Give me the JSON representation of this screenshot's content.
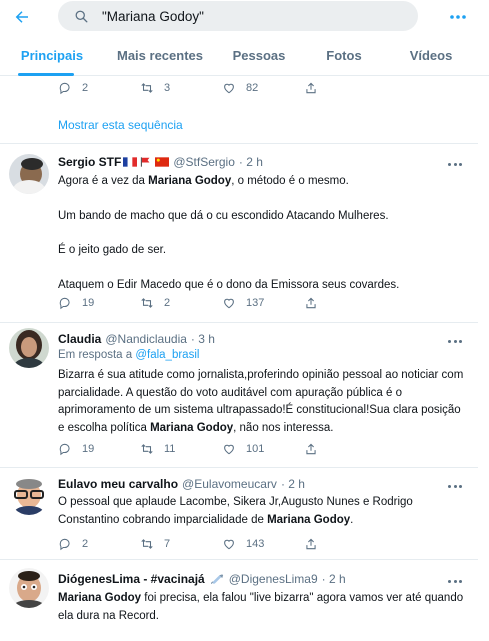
{
  "search": {
    "query": "\"Mariana Godoy\""
  },
  "tabs": [
    {
      "label": "Principais",
      "active": true
    },
    {
      "label": "Mais recentes",
      "active": false
    },
    {
      "label": "Pessoas",
      "active": false
    },
    {
      "label": "Fotos",
      "active": false
    },
    {
      "label": "Vídeos",
      "active": false
    }
  ],
  "prev_tweet": {
    "replies": "2",
    "retweets": "3",
    "likes": "82"
  },
  "show_thread": "Mostrar esta sequência",
  "tweets": [
    {
      "name": "Sergio STF",
      "handle": "@StfSergio",
      "time": "· 2 h",
      "pre": "Agora é a vez da ",
      "bold": "Mariana Godoy",
      "post": ", o método é o mesmo.",
      "p2": "Um bando de macho que dá o cu escondido Atacando Mulheres.",
      "p3": "É o jeito gado de ser.",
      "p4": "Ataquem o Edir Macedo que é o dono da Emissora seus covardes.",
      "replies": "19",
      "retweets": "2",
      "likes": "137"
    },
    {
      "name": "Claudia",
      "handle": "@Nandiclaudia",
      "time": "· 3 h",
      "reply_prefix": "Em resposta a ",
      "reply_to": "@fala_brasil",
      "pre": "Bizarra é sua atitude como jornalista,proferindo opinião pessoal ao noticiar com parcialidade. A questão do voto auditável com apuração pública é o aprimoramento de um sistema ultrapassado!É constitucional!Sua clara posição e escolha política ",
      "bold": "Mariana Godoy",
      "post": ", não nos interessa.",
      "replies": "19",
      "retweets": "11",
      "likes": "101"
    },
    {
      "name": "Eulavo meu carvalho",
      "handle": "@Eulavomeucarv",
      "time": "· 2 h",
      "pre": "O pessoal que aplaude Lacombe, Sikera Jr,Augusto Nunes e Rodrigo Constantino cobrando imparcialidade de ",
      "bold": "Mariana Godoy",
      "post": ".",
      "replies": "2",
      "retweets": "7",
      "likes": "143"
    },
    {
      "name": "DiógenesLima - #vacinajá",
      "handle": "@DigenesLima9",
      "time": "· 2 h",
      "bold": "Mariana Godoy",
      "post": " foi precisa, ela falou \"live bizarra\" agora vamos ver até quando ela dura na Record."
    }
  ],
  "colors": {
    "accent": "#1da1f2",
    "muted": "#5b7083",
    "text": "#0f1419"
  }
}
